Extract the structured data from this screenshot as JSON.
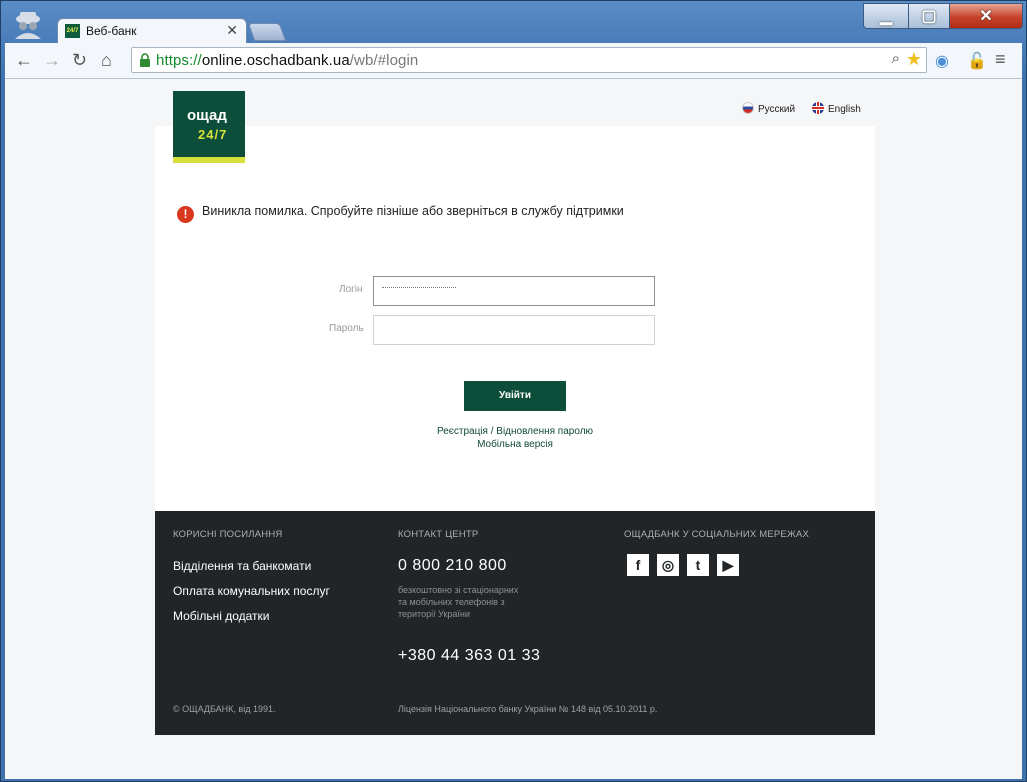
{
  "browser": {
    "tab_title": "Веб-банк",
    "tab_favicon_text": "24/7",
    "tab_close": "✕",
    "url_scheme": "https://",
    "url_host": "online.oschadbank.ua",
    "url_path": "/wb/#login",
    "icons": [
      "incognito-icon",
      "back-icon",
      "forward-icon",
      "reload-icon",
      "home-icon",
      "lock-icon",
      "zoom-icon",
      "star-icon",
      "extension-icon",
      "security-icon",
      "menu-icon"
    ]
  },
  "header": {
    "logo_line1": "ощад",
    "logo_line2": "24/7",
    "lang_ru": "Русский",
    "lang_en": "English"
  },
  "login": {
    "error_message": "Виникла помилка. Спробуйте пізніше або зверніться в службу підтримки",
    "login_label": "Логін",
    "password_label": "Пароль",
    "submit_label": "Увійти",
    "link_register": "Реєстрація",
    "link_separator": "/",
    "link_recover": "Відновлення паролю",
    "link_mobile": "Мобільна версія"
  },
  "footer": {
    "useful_heading": "КОРИСНІ ПОСИЛАННЯ",
    "useful_links": [
      "Відділення та банкомати",
      "Оплата комунальних послуг",
      "Мобільні додатки"
    ],
    "contact_heading": "КОНТАКТ ЦЕНТР",
    "phone_free": "0 800 210 800",
    "phone_note_1": "безкоштовно зі стаціонарних",
    "phone_note_2": "та мобільних телефонів з",
    "phone_note_3": "території України",
    "phone_intl": "+380 44 363 01 33",
    "social_heading": "ОЩАДБАНК У СОЦІАЛЬНИХ МЕРЕЖАХ",
    "social_icons": [
      "facebook-icon",
      "instagram-icon",
      "twitter-icon",
      "youtube-icon"
    ],
    "copyright": "© ОЩАДБАНК, від 1991.",
    "license": "Ліцензія Національного банку України № 148 від 05.10.2011 р."
  },
  "colors": {
    "brand_green": "#0c4e3a",
    "brand_yellow": "#d6e03a",
    "footer_bg": "#212528",
    "error_red": "#d9371e"
  }
}
